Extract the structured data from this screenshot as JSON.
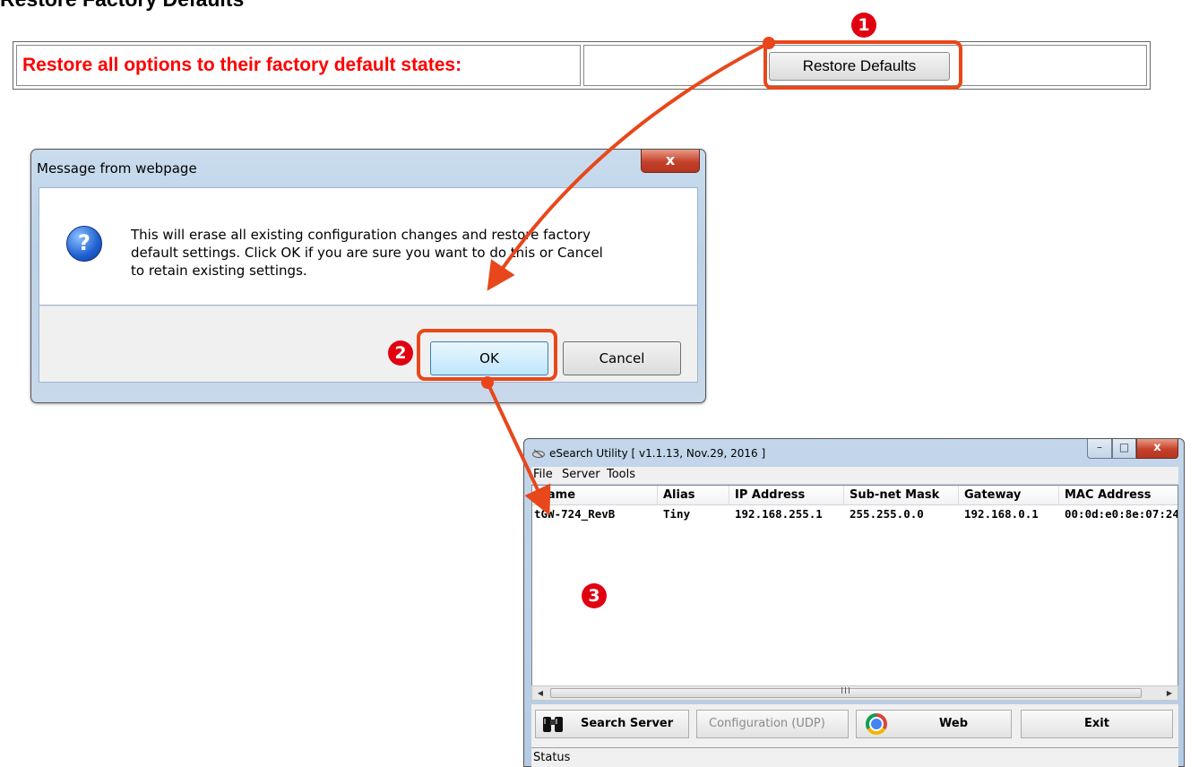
{
  "page": {
    "heading": "Restore Factory Defaults",
    "form_label": "Restore all options to their factory default states:",
    "restore_button": "Restore Defaults"
  },
  "dialog": {
    "title": "Message from webpage",
    "close_glyph": "x",
    "icon": "question-icon",
    "icon_glyph": "?",
    "message": "This will erase all existing configuration changes and restore factory\ndefault settings. Click OK if you are sure you want to do this or Cancel\nto retain existing settings.",
    "ok_button": "OK",
    "cancel_button": "Cancel"
  },
  "utility": {
    "title": "eSearch Utility [ v1.1.13, Nov.29, 2016 ]",
    "window_buttons": {
      "minimize": "–",
      "maximize": "□",
      "close": "x"
    },
    "menu": [
      "File",
      "Server",
      "Tools"
    ],
    "columns": [
      "Name",
      "Alias",
      "IP Address",
      "Sub-net Mask",
      "Gateway",
      "MAC Address"
    ],
    "rows": [
      [
        "tGW-724_RevB",
        "Tiny",
        "192.168.255.1",
        "255.255.0.0",
        "192.168.0.1",
        "00:0d:e0:8e:07:24"
      ]
    ],
    "scroll_grip": "III",
    "scroll_left": "◀",
    "scroll_right": "▶",
    "buttons": {
      "search_server": "Search Server",
      "configuration": "Configuration (UDP)",
      "web": "Web",
      "exit": "Exit"
    },
    "status": "Status"
  },
  "annotations": {
    "step1": "1",
    "step2": "2",
    "step3": "3",
    "accent_color": "#e8471b",
    "badge_color": "#e10010"
  }
}
